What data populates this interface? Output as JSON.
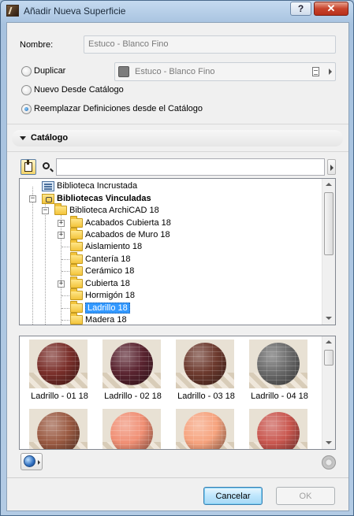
{
  "window": {
    "title": "Añadir Nueva Superficie",
    "help_label": "?",
    "close_label": "✕"
  },
  "form": {
    "nombre_label": "Nombre:",
    "nombre_value": "Estuco - Blanco Fino",
    "duplicar_label": "Duplicar",
    "duplicar_value": "Estuco - Blanco Fino",
    "nuevo_label": "Nuevo Desde Catálogo",
    "reemplazar_label": "Reemplazar Definiciones desde el Catálogo",
    "selected_option": "reemplazar"
  },
  "catalog": {
    "section_title": "Catálogo",
    "search_value": "",
    "tree": [
      {
        "label": "Biblioteca Incrustada",
        "icon": "embedded-library-icon",
        "bold": false
      },
      {
        "label": "Bibliotecas Vinculadas",
        "icon": "linked-libraries-icon",
        "bold": true,
        "expander": "−"
      },
      {
        "label": "Biblioteca ArchiCAD 18",
        "icon": "folder-icon",
        "expander": "−"
      },
      {
        "label": "Acabados Cubierta 18",
        "icon": "folder-icon",
        "expander": "+"
      },
      {
        "label": "Acabados de Muro 18",
        "icon": "folder-icon",
        "expander": "+"
      },
      {
        "label": "Aislamiento 18",
        "icon": "folder-icon"
      },
      {
        "label": "Cantería 18",
        "icon": "folder-icon"
      },
      {
        "label": "Cerámico 18",
        "icon": "folder-icon"
      },
      {
        "label": "Cubierta 18",
        "icon": "folder-icon",
        "expander": "+"
      },
      {
        "label": "Hormigón 18",
        "icon": "folder-icon"
      },
      {
        "label": "Ladrillo 18",
        "icon": "folder-icon",
        "selected": true
      },
      {
        "label": "Madera 18",
        "icon": "folder-icon"
      }
    ],
    "materials": [
      {
        "label": "Ladrillo - 01 18",
        "color": "#7a2f2a"
      },
      {
        "label": "Ladrillo - 02 18",
        "color": "#5a2430"
      },
      {
        "label": "Ladrillo - 03 18",
        "color": "#6d3a2e"
      },
      {
        "label": "Ladrillo - 04 18",
        "color": "#6a6a6a"
      },
      {
        "label": "",
        "color": "#9a5a42"
      },
      {
        "label": "",
        "color": "#f08f74"
      },
      {
        "label": "",
        "color": "#f6a37e"
      },
      {
        "label": "",
        "color": "#c9574f"
      }
    ]
  },
  "footer": {
    "cancel_label": "Cancelar",
    "ok_label": "OK"
  }
}
